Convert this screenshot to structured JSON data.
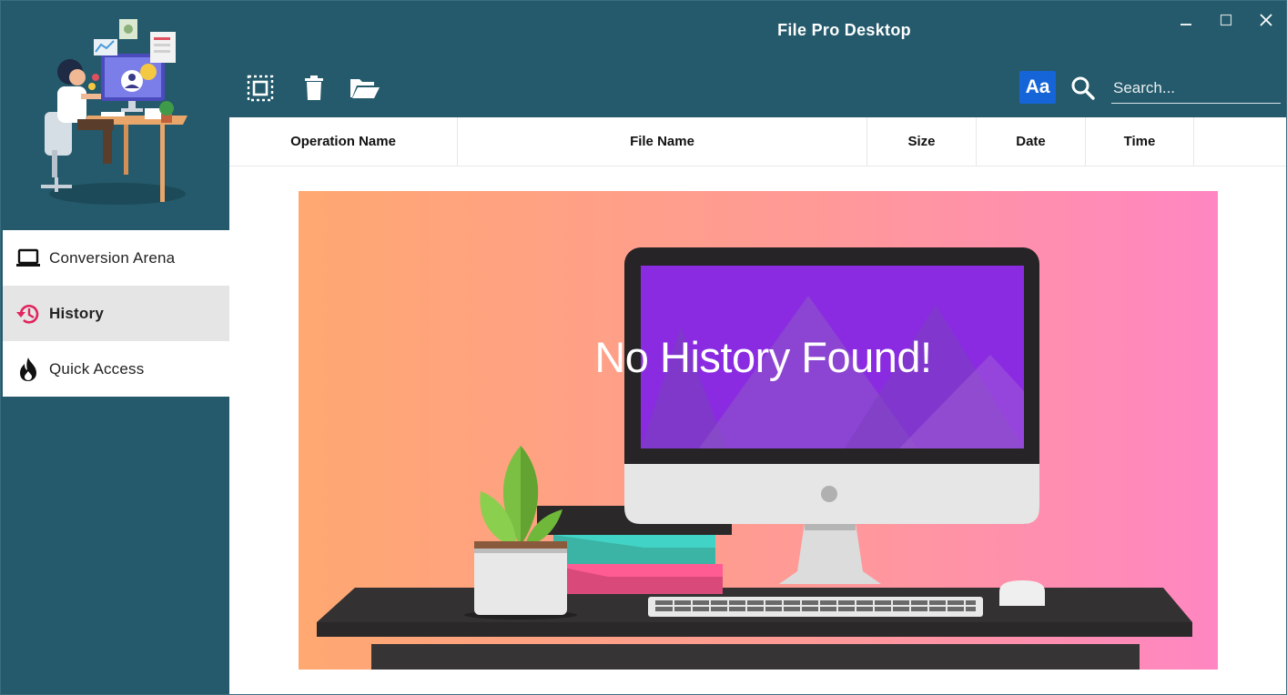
{
  "window": {
    "title": "File Pro Desktop"
  },
  "sidebar": {
    "items": [
      {
        "label": "Conversion Arena",
        "icon": "laptop-icon",
        "active": false
      },
      {
        "label": "History",
        "icon": "history-icon",
        "active": true
      },
      {
        "label": "Quick Access",
        "icon": "flame-icon",
        "active": false
      }
    ]
  },
  "toolbar": {
    "buttons": [
      "select-all-icon",
      "trash-icon",
      "folder-open-icon"
    ],
    "font_button_label": "Aa",
    "search_placeholder": "Search..."
  },
  "table": {
    "columns": [
      "Operation Name",
      "File Name",
      "Size",
      "Date",
      "Time"
    ]
  },
  "empty_state": {
    "message": "No History Found!"
  },
  "colors": {
    "sidebar": "#245a6b",
    "accent_blue": "#1565d8",
    "history_icon": "#e0245e",
    "active_nav_bg": "#e5e5e5"
  }
}
